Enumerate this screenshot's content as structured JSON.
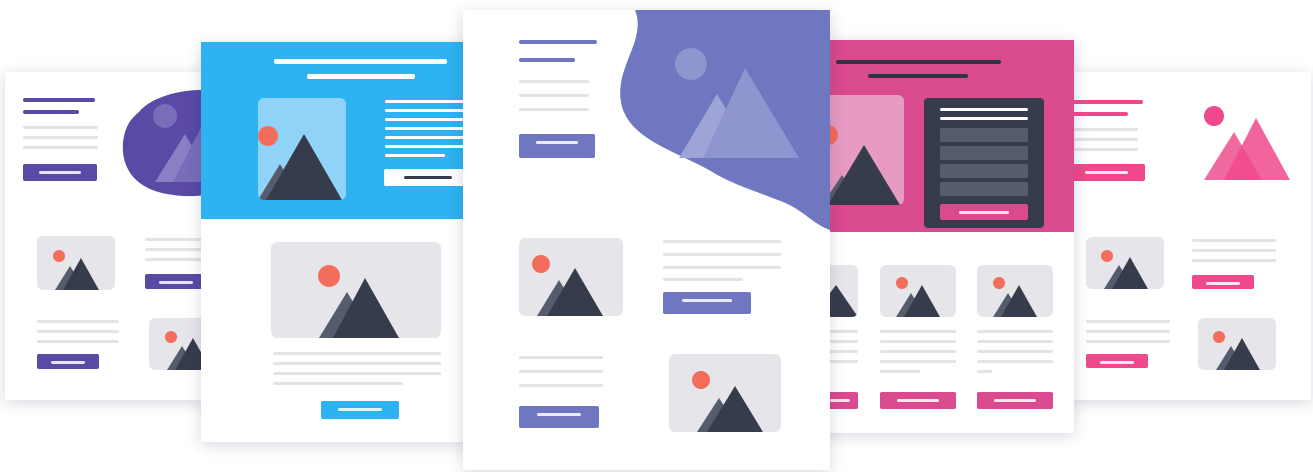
{
  "colors": {
    "purple": "#5b49a6",
    "sky_blue": "#2db2f2",
    "periwinkle": "#6e77bf",
    "magenta": "#d94a8e",
    "pink": "#f0498b",
    "dark_slate": "#363c4b",
    "line_gray": "#e3e3e6",
    "image_placeholder": "#e6e6ea",
    "sun_orange": "#f26d5a"
  },
  "templates": [
    {
      "theme": "purple",
      "hero": "blob-image",
      "accent": "#5b49a6",
      "icon": "mountain-image-icon"
    },
    {
      "theme": "blue",
      "hero": "header-banner",
      "accent": "#2db2f2",
      "icon": "mountain-image-icon"
    },
    {
      "theme": "periwinkle",
      "hero": "wave-shape",
      "accent": "#6e77bf",
      "icon": "mountain-image-icon"
    },
    {
      "theme": "magenta",
      "hero": "header-with-form",
      "accent": "#d94a8e",
      "icon": "mountain-image-icon"
    },
    {
      "theme": "pink",
      "hero": "floating-image",
      "accent": "#f0498b",
      "icon": "mountain-image-icon"
    }
  ]
}
